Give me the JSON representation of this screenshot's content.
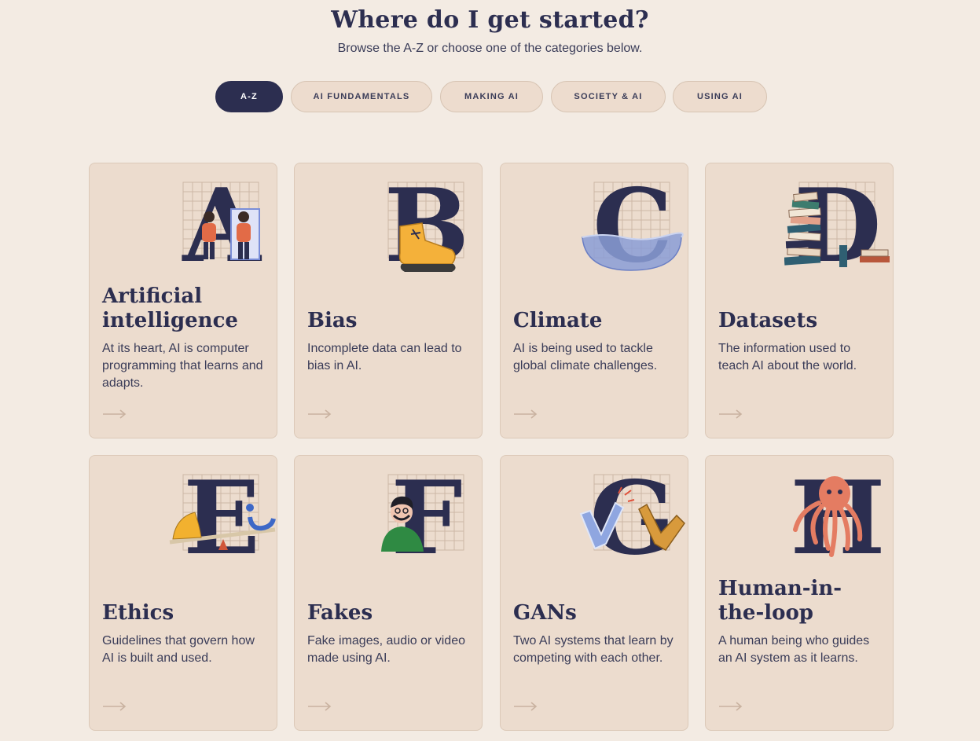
{
  "header": {
    "title": "Where do I get started?",
    "subtitle": "Browse the A-Z or choose one of the categories below."
  },
  "filters": [
    {
      "label": "A-Z",
      "active": true
    },
    {
      "label": "AI FUNDAMENTALS",
      "active": false
    },
    {
      "label": "MAKING AI",
      "active": false
    },
    {
      "label": "SOCIETY & AI",
      "active": false
    },
    {
      "label": "USING AI",
      "active": false
    }
  ],
  "cards": [
    {
      "letter": "A",
      "title": "Artificial intelligence",
      "description": "At its heart, AI is computer programming that learns and adapts.",
      "icon": "mirror-figures-icon"
    },
    {
      "letter": "B",
      "title": "Bias",
      "description": "Incomplete data can lead to bias in AI.",
      "icon": "sneaker-icon"
    },
    {
      "letter": "C",
      "title": "Climate",
      "description": "AI is being used to tackle global climate challenges.",
      "icon": "water-bowl-icon"
    },
    {
      "letter": "D",
      "title": "Datasets",
      "description": "The information used to teach AI about the world.",
      "icon": "book-stack-icon"
    },
    {
      "letter": "E",
      "title": "Ethics",
      "description": "Guidelines that govern how AI is built and used.",
      "icon": "balance-scale-icon"
    },
    {
      "letter": "F",
      "title": "Fakes",
      "description": "Fake images, audio or video made using AI.",
      "icon": "disguised-person-icon"
    },
    {
      "letter": "G",
      "title": "GANs",
      "description": "Two AI systems that learn by competing with each other.",
      "icon": "robot-arms-icon"
    },
    {
      "letter": "H",
      "title": "Human-in-the-loop",
      "description": "A human being who guides an AI system as it learns.",
      "icon": "octopus-icon"
    }
  ]
}
